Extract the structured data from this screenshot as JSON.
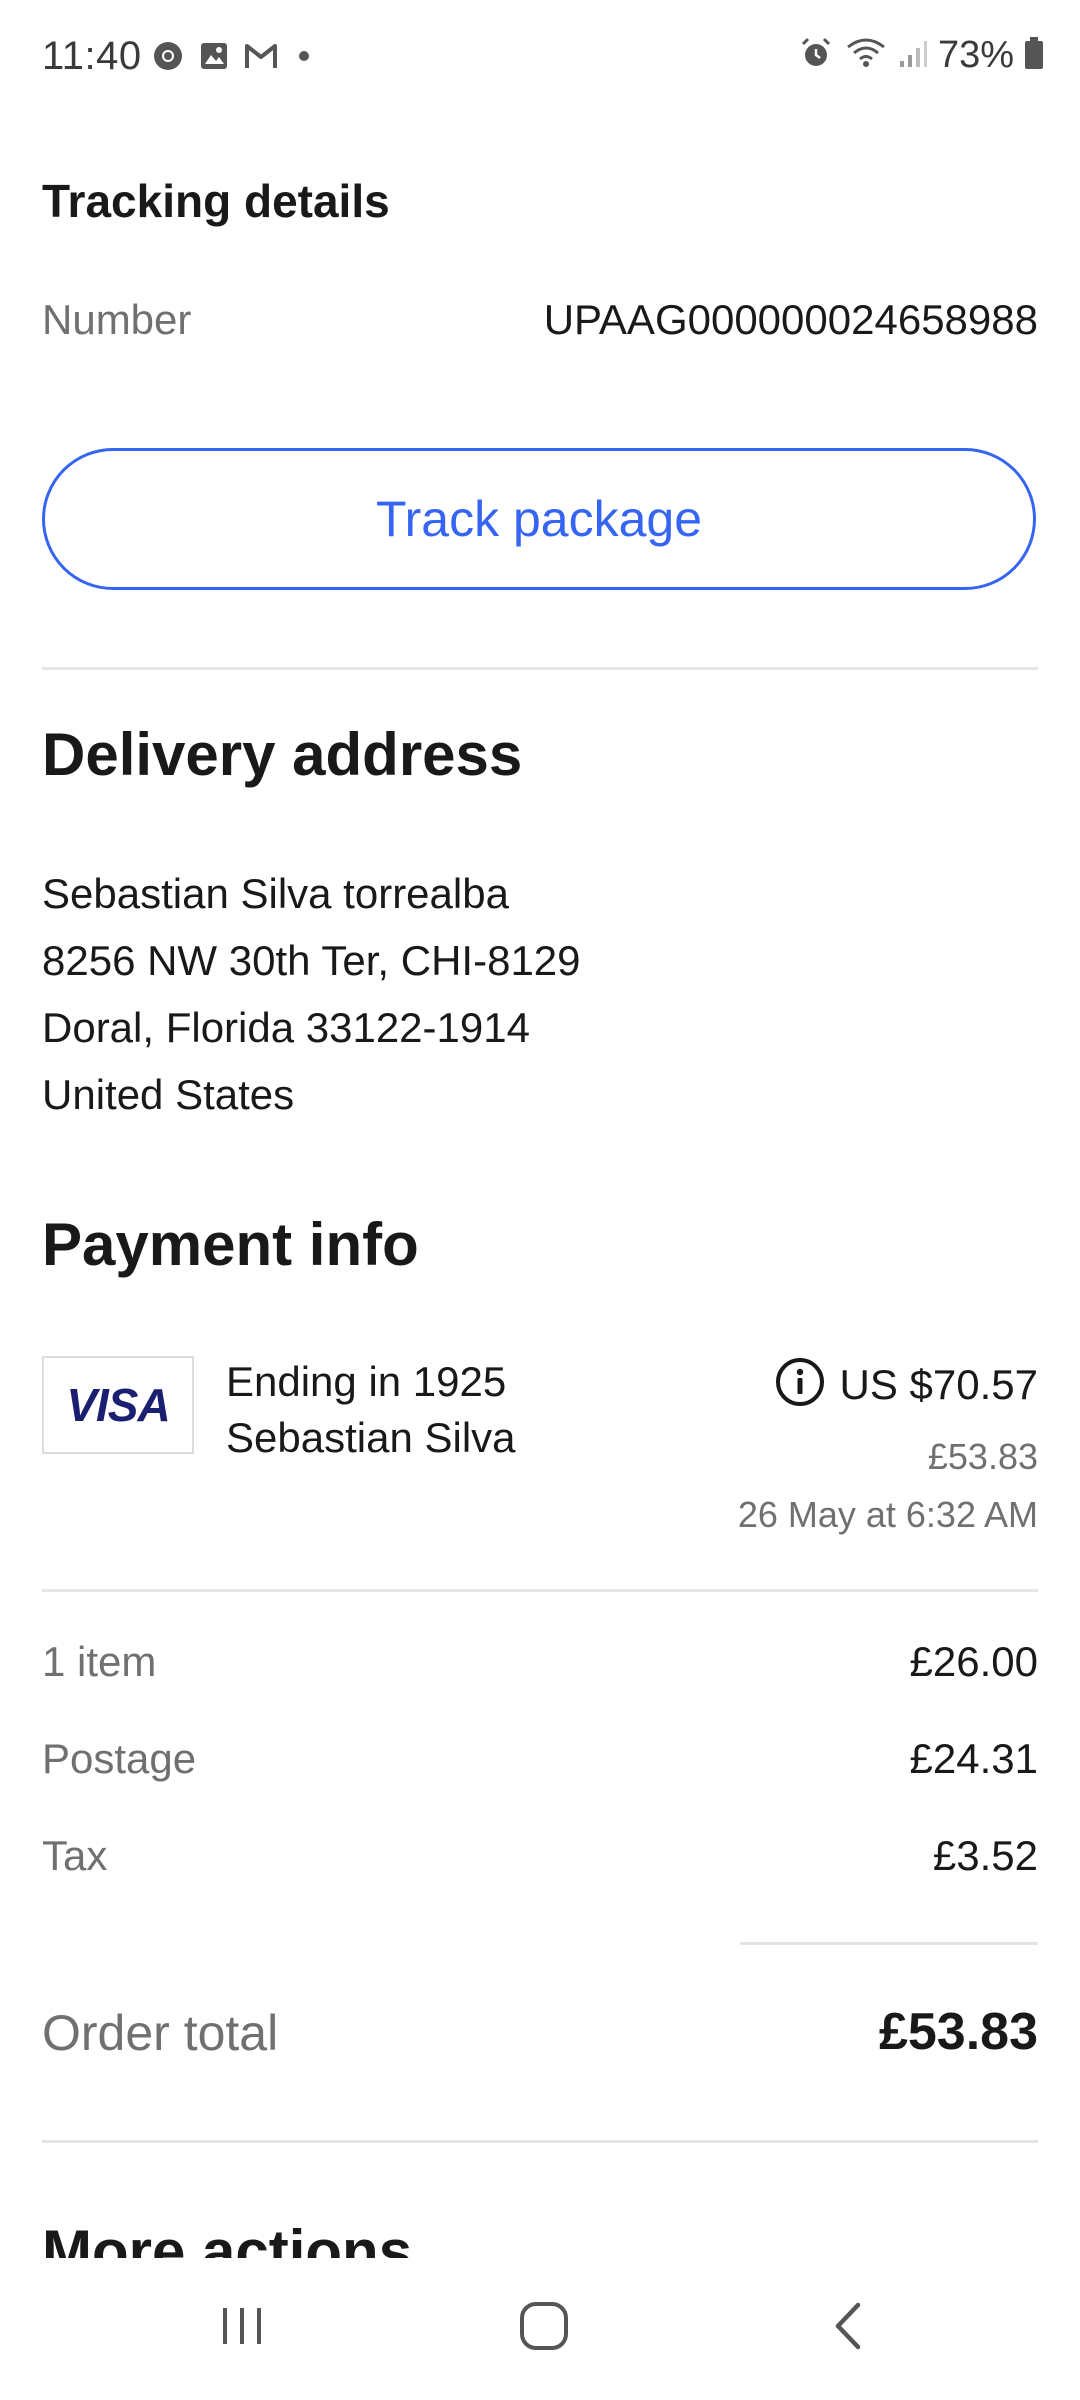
{
  "status_bar": {
    "time": "11:40",
    "left_icons": [
      "chrome-icon",
      "gallery-icon",
      "gmail-icon",
      "notification-dot-icon"
    ],
    "right_icons": [
      "alarm-icon",
      "wifi-icon",
      "signal-icon"
    ],
    "battery": "73%"
  },
  "tracking": {
    "title": "Tracking details",
    "number_label": "Number",
    "number_value": "UPAAG000000024658988",
    "track_button": "Track package"
  },
  "delivery": {
    "title": "Delivery address",
    "lines": [
      "Sebastian Silva torrealba",
      "8256 NW 30th Ter, CHI-8129",
      "Doral, Florida 33122-1914",
      "United States"
    ]
  },
  "payment": {
    "title": "Payment info",
    "card_brand": "VISA",
    "card_ending": "Ending in 1925",
    "card_holder": "Sebastian Silva",
    "amount_usd": "US $70.57",
    "amount_gbp": "£53.83",
    "date": "26 May at 6:32 AM",
    "info_icon": "info-icon"
  },
  "summary": {
    "rows": [
      {
        "label": "1 item",
        "value": "£26.00"
      },
      {
        "label": "Postage",
        "value": "£24.31"
      },
      {
        "label": "Tax",
        "value": "£3.52"
      }
    ],
    "total_label": "Order total",
    "total_value": "£53.83"
  },
  "more_actions": {
    "title": "More actions"
  },
  "nav_bar": {
    "buttons": [
      "recents-icon",
      "home-icon",
      "back-icon"
    ]
  },
  "colors": {
    "accent": "#3665f3",
    "text": "#191919",
    "muted": "#707070",
    "visa": "#1a1f71"
  }
}
